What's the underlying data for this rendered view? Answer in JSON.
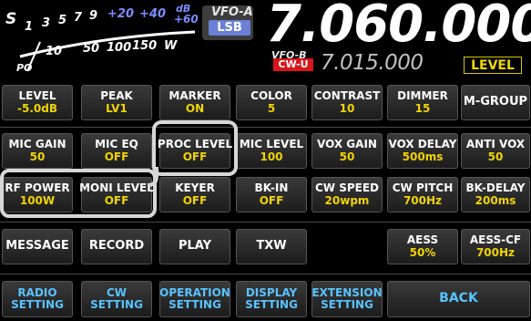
{
  "meter": {
    "s_scale": [
      "S",
      "1",
      "3",
      "5",
      "7",
      "9",
      "+20",
      "+40",
      "dB",
      "+60"
    ],
    "po_scale": [
      "PO",
      "10",
      "50",
      "100",
      "150",
      "W"
    ]
  },
  "vfo": {
    "a_label": "VFO-A",
    "a_mode": "LSB",
    "a_freq": "7.060.000",
    "b_label": "VFO-B",
    "b_mode": "CW-U",
    "b_freq": "7.015.000",
    "level_label": "LEVEL"
  },
  "rows": [
    [
      {
        "l1": "LEVEL",
        "l2": "-5.0dB"
      },
      {
        "l1": "PEAK",
        "l2": "LV1"
      },
      {
        "l1": "MARKER",
        "l2": "ON"
      },
      {
        "l1": "COLOR",
        "l2": "5"
      },
      {
        "l1": "CONTRAST",
        "l2": "10"
      },
      {
        "l1": "DIMMER",
        "l2": "15"
      },
      {
        "l1": "M-GROUP",
        "l2": ""
      }
    ],
    [
      {
        "l1": "MIC GAIN",
        "l2": "50"
      },
      {
        "l1": "MIC EQ",
        "l2": "OFF"
      },
      {
        "l1": "PROC LEVEL",
        "l2": "OFF"
      },
      {
        "l1": "MIC LEVEL",
        "l2": "100"
      },
      {
        "l1": "VOX GAIN",
        "l2": "50"
      },
      {
        "l1": "VOX DELAY",
        "l2": "500ms"
      },
      {
        "l1": "ANTI VOX",
        "l2": "50"
      }
    ],
    [
      {
        "l1": "RF POWER",
        "l2": "100W"
      },
      {
        "l1": "MONI LEVEL",
        "l2": "OFF"
      },
      {
        "l1": "KEYER",
        "l2": "OFF"
      },
      {
        "l1": "BK-IN",
        "l2": "OFF"
      },
      {
        "l1": "CW SPEED",
        "l2": "20wpm"
      },
      {
        "l1": "CW PITCH",
        "l2": "700Hz"
      },
      {
        "l1": "BK-DELAY",
        "l2": "200ms"
      }
    ],
    [
      {
        "l1": "MESSAGE",
        "l2": ""
      },
      {
        "l1": "RECORD",
        "l2": ""
      },
      {
        "l1": "PLAY",
        "l2": ""
      },
      {
        "l1": "TXW",
        "l2": ""
      },
      {
        "l1": "AESS",
        "l2": "50%"
      },
      {
        "l1": "AESS-CF",
        "l2": "700Hz"
      }
    ]
  ],
  "bottom": [
    {
      "l1": "RADIO",
      "l2": "SETTING"
    },
    {
      "l1": "CW",
      "l2": "SETTING"
    },
    {
      "l1": "OPERATION",
      "l2": "SETTING"
    },
    {
      "l1": "DISPLAY",
      "l2": "SETTING"
    },
    {
      "l1": "EXTENSION",
      "l2": "SETTING"
    },
    {
      "l1": "BACK",
      "l2": ""
    }
  ],
  "colors": {
    "value_yellow": "#f2d400",
    "setting_blue": "#58c3ff",
    "mode_lsb_bg": "#6b7fd6",
    "mode_cw_bg": "#d8161a",
    "level_yellow": "#f2d800",
    "highlight": "#d7d7d7"
  }
}
